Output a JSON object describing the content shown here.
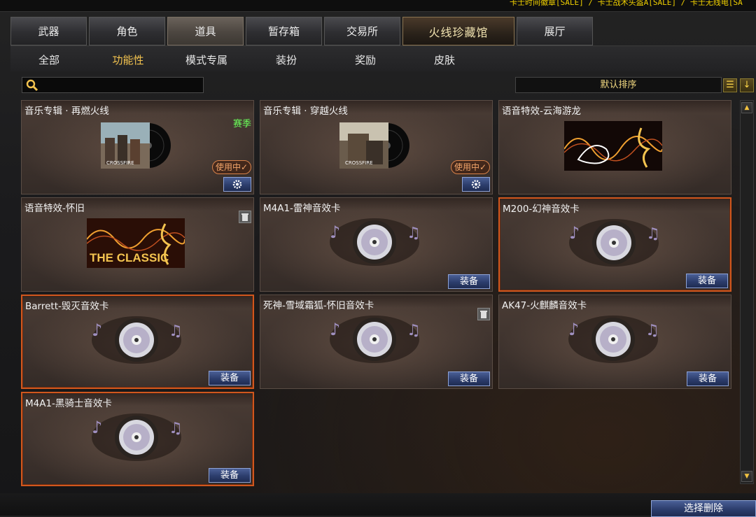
{
  "ticker": "卡士时间徽章[SALE] / 卡士战术头盔A[SALE] / 卡士无线电[SA",
  "tabs": [
    {
      "label": "武器"
    },
    {
      "label": "角色"
    },
    {
      "label": "道具"
    },
    {
      "label": "暂存箱"
    },
    {
      "label": "交易所"
    },
    {
      "label": "火线珍藏馆"
    },
    {
      "label": "展厅"
    }
  ],
  "subnav": [
    {
      "label": "全部"
    },
    {
      "label": "功能性"
    },
    {
      "label": "模式专属"
    },
    {
      "label": "装扮"
    },
    {
      "label": "奖励"
    },
    {
      "label": "皮肤"
    }
  ],
  "sort": {
    "label": "默认排序"
  },
  "items": [
    {
      "title": "音乐专辑 · 再燃火线",
      "badge": "赛季",
      "status": "使用中✓"
    },
    {
      "title": "音乐专辑 · 穿越火线",
      "status": "使用中✓"
    },
    {
      "title": "语音特效-云海游龙"
    },
    {
      "title": "语音特效-怀旧",
      "art_text": "THE CLASSIC"
    },
    {
      "title": "M4A1-雷神音效卡",
      "action": "装备"
    },
    {
      "title": "M200-幻神音效卡",
      "action": "装备"
    },
    {
      "title": "Barrett-毁灭音效卡",
      "action": "装备"
    },
    {
      "title": "死神-雪域霜狐-怀旧音效卡",
      "action": "装备"
    },
    {
      "title": "AK47-火麒麟音效卡",
      "action": "装备"
    },
    {
      "title": "M4A1-黑骑士音效卡",
      "action": "装备"
    }
  ],
  "footer": {
    "delete_label": "选择删除"
  },
  "colors": {
    "accent": "#f3c34f",
    "selected_border": "#d0571e",
    "button_blue": "#2c3d6c",
    "season_green": "#6aff5a"
  },
  "album_logo": "CROSSFIRE"
}
